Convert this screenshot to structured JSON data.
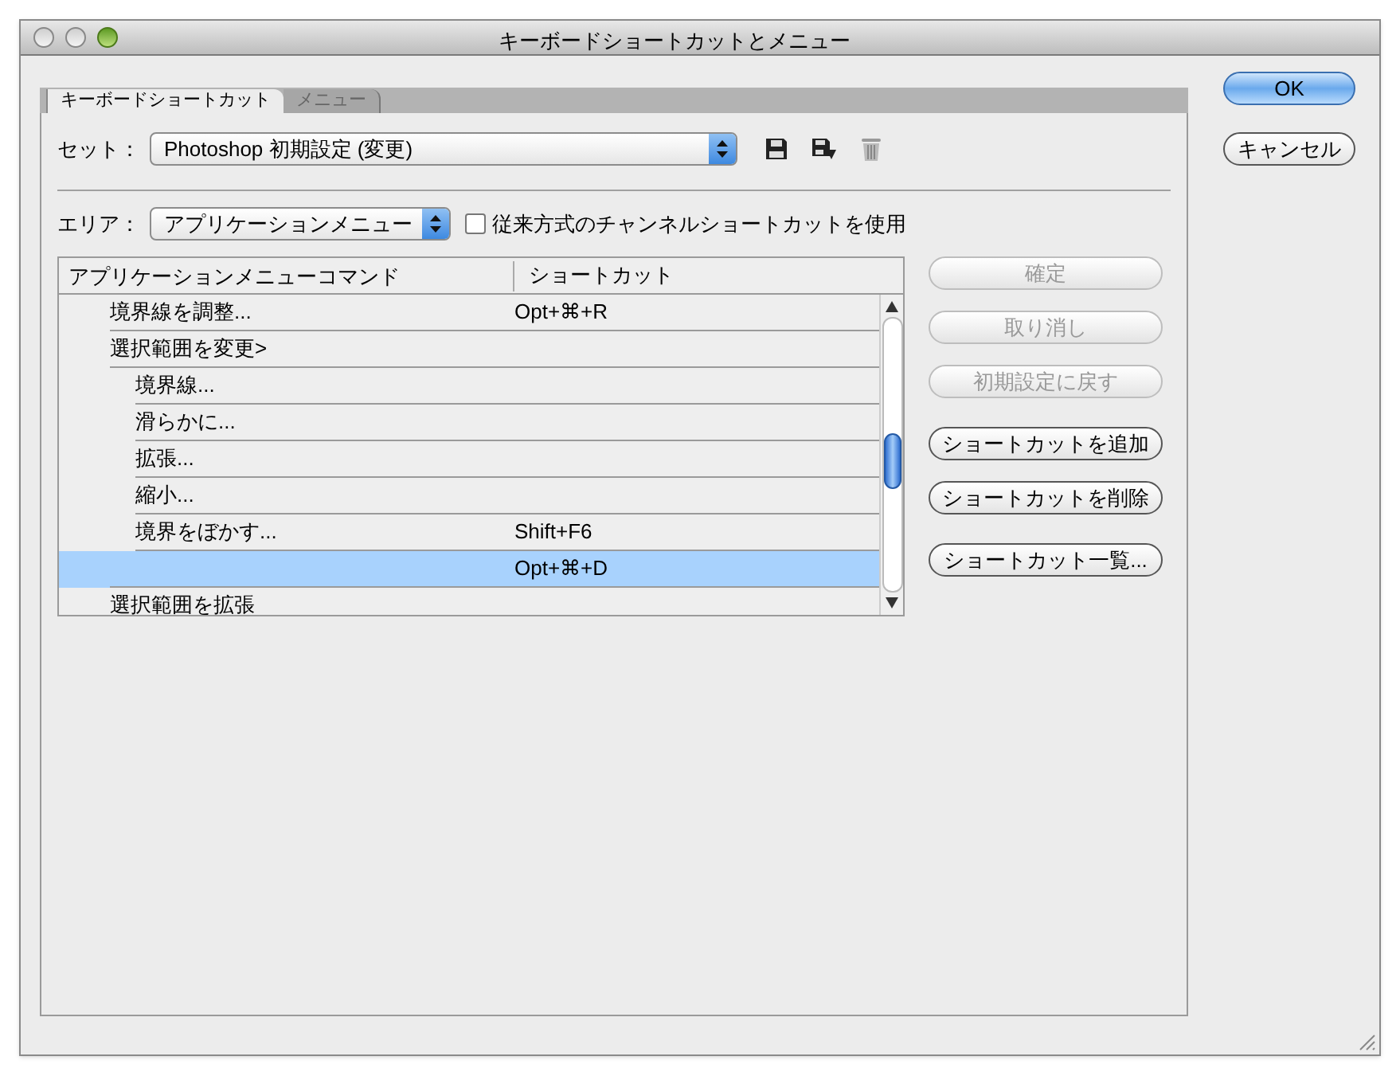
{
  "window": {
    "title": "キーボードショートカットとメニュー"
  },
  "tabs": [
    {
      "label": "キーボードショートカット",
      "selected": true
    },
    {
      "label": "メニュー",
      "selected": false
    }
  ],
  "set": {
    "label": "セット：",
    "value": "Photoshop 初期設定 (変更)"
  },
  "area": {
    "label": "エリア：",
    "value": "アプリケーションメニュー",
    "legacy_checkbox": {
      "label": "従来方式のチャンネルショートカットを使用",
      "checked": false
    }
  },
  "table": {
    "columns": [
      "アプリケーションメニューコマンド",
      "ショートカット"
    ],
    "rows": [
      {
        "command": "境界線を調整...",
        "shortcut": "Opt+⌘+R",
        "selected": false
      },
      {
        "command": "選択範囲を変更>",
        "selected": false,
        "children": [
          {
            "command": "境界線...",
            "selected": false
          },
          {
            "command": "滑らかに...",
            "selected": false
          },
          {
            "command": "拡張...",
            "selected": false
          },
          {
            "command": "縮小...",
            "selected": false
          },
          {
            "command": "境界をぼかす...",
            "shortcut": "Shift+F6",
            "selected": false
          }
        ]
      },
      {
        "shortcut": "Opt+⌘+D",
        "selected": true
      },
      {
        "command": "選択範囲を拡張",
        "selected": false
      }
    ]
  },
  "side_buttons": [
    {
      "label": "確定",
      "disabled": true
    },
    {
      "label": "取り消し",
      "disabled": true
    },
    {
      "label": "初期設定に戻す",
      "disabled": true
    },
    {
      "label": "ショートカットを追加",
      "disabled": false
    },
    {
      "label": "ショートカットを削除",
      "disabled": false
    },
    {
      "label": "ショートカット一覧...",
      "disabled": false
    }
  ],
  "dialog_buttons": [
    {
      "label": "OK",
      "default": true
    },
    {
      "label": "キャンセル",
      "default": false
    }
  ]
}
